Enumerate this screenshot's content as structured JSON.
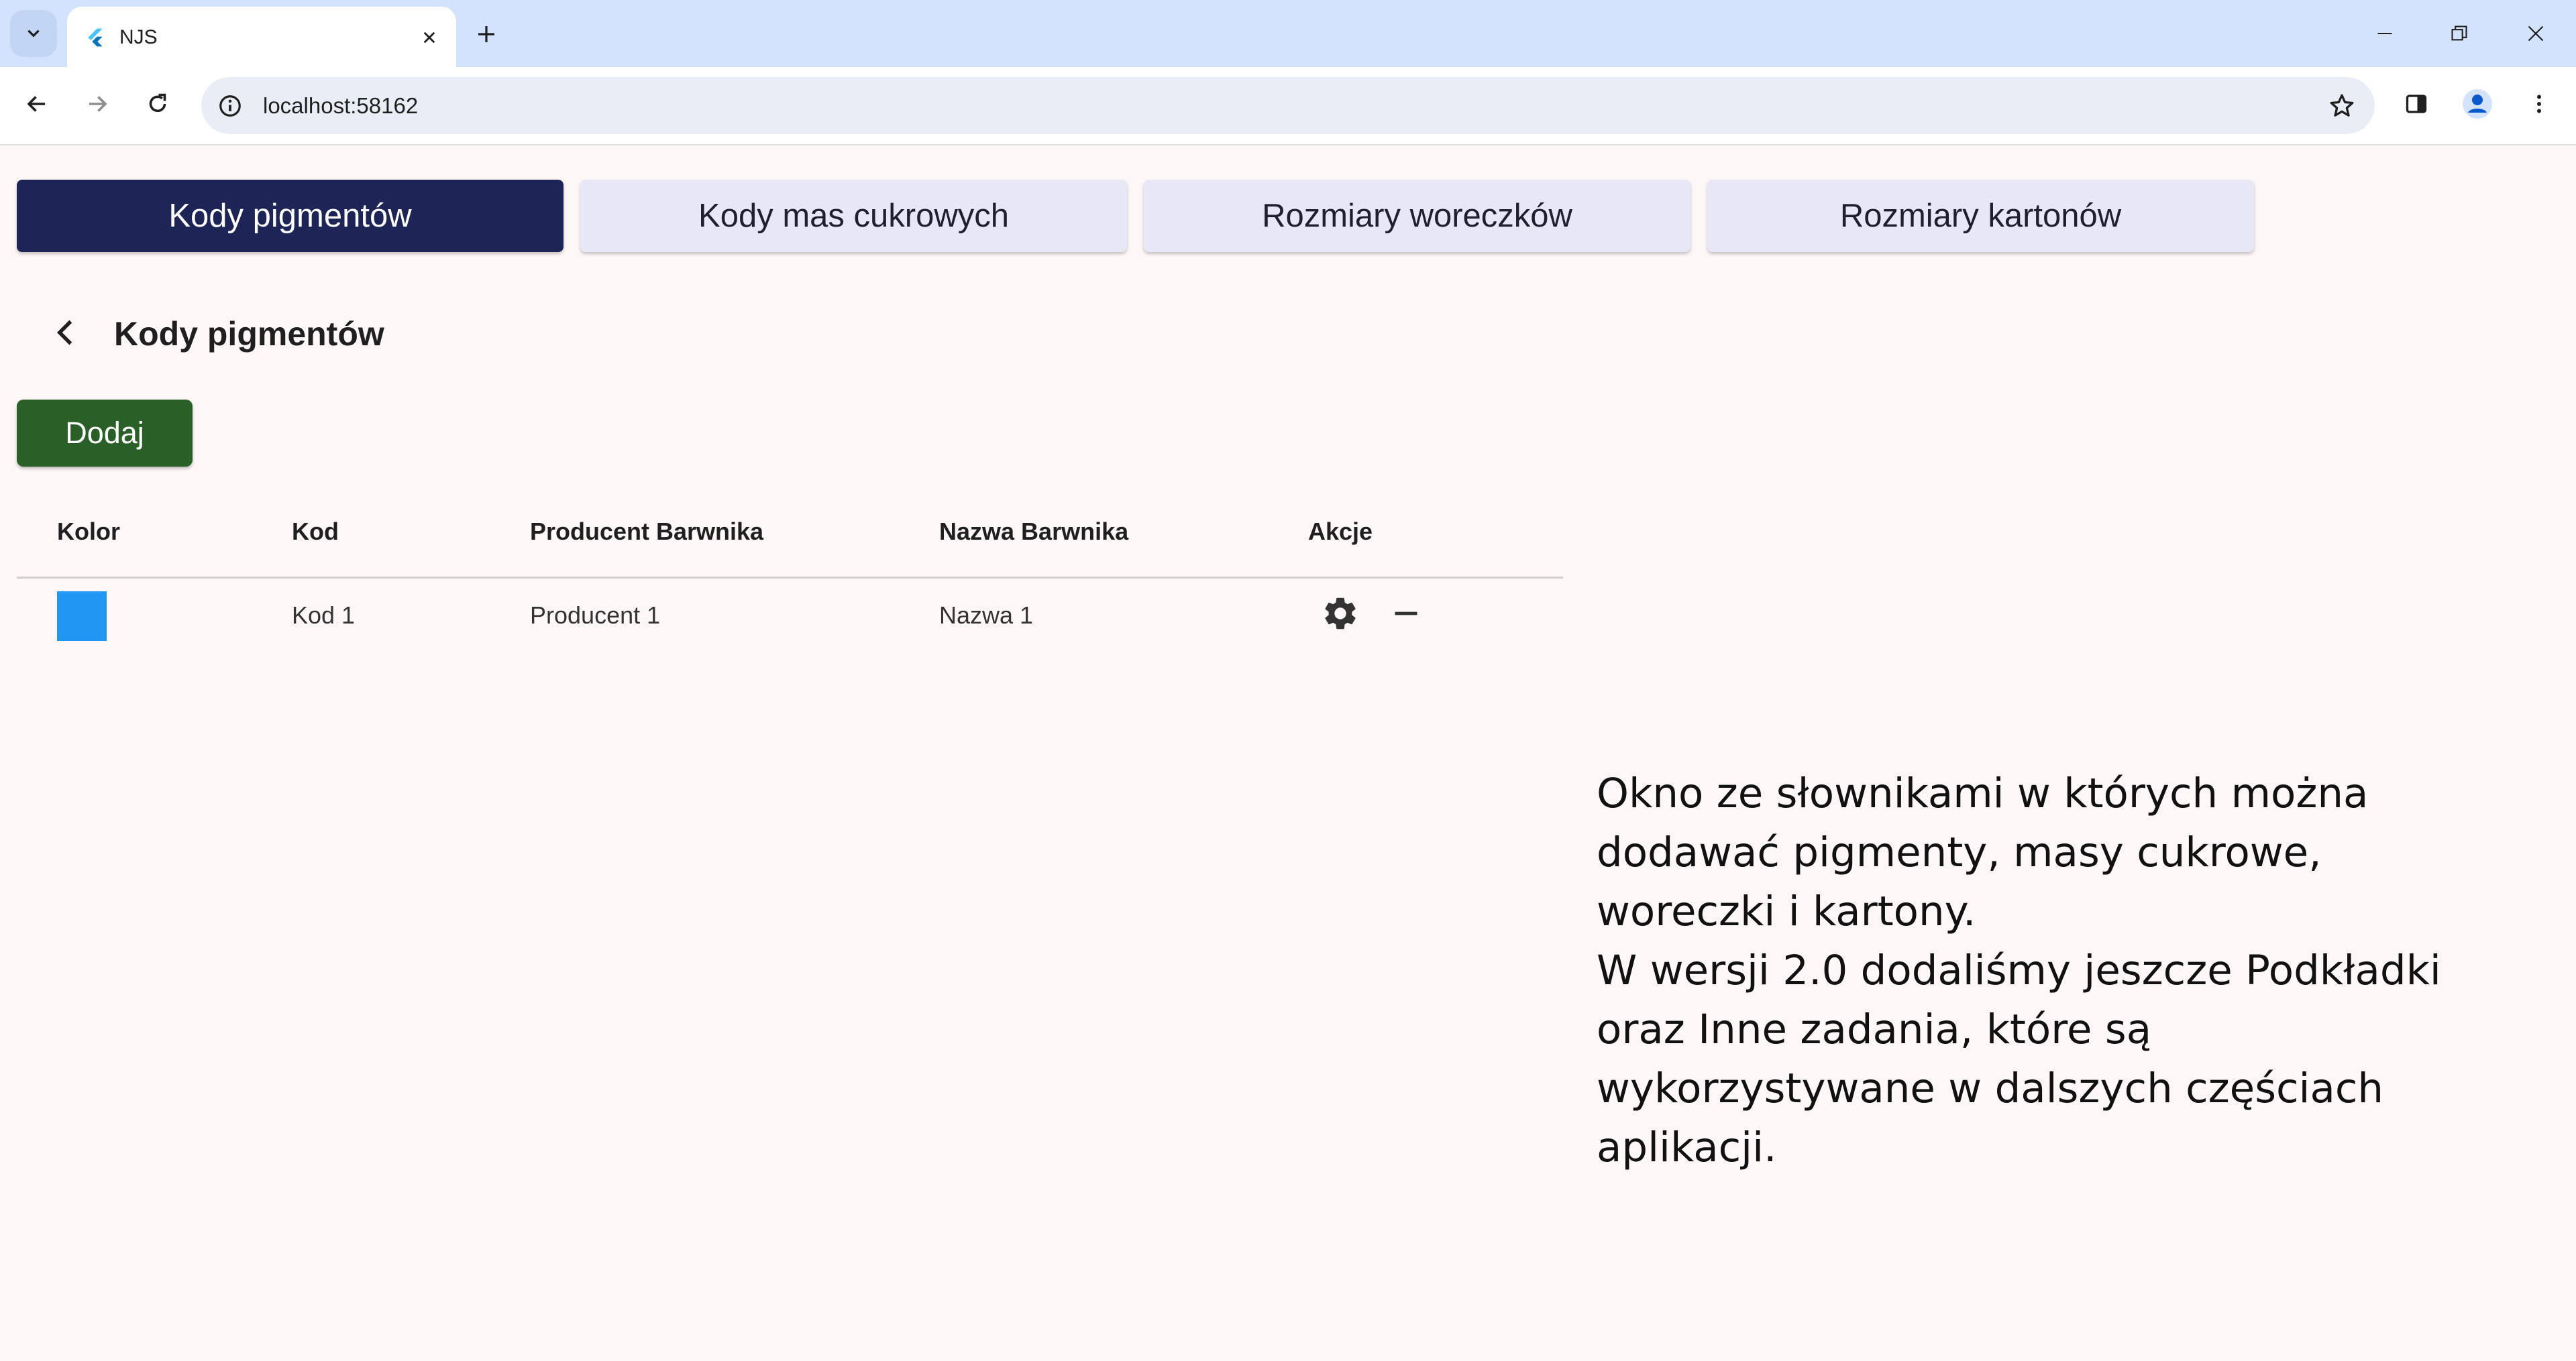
{
  "browser": {
    "tab_title": "NJS",
    "url": "localhost:58162"
  },
  "app": {
    "tabs": [
      {
        "label": "Kody pigmentów",
        "active": true
      },
      {
        "label": "Kody mas cukrowych",
        "active": false
      },
      {
        "label": "Rozmiary woreczków",
        "active": false
      },
      {
        "label": "Rozmiary kartonów",
        "active": false
      }
    ],
    "page_title": "Kody pigmentów",
    "add_button_label": "Dodaj",
    "table": {
      "headers": [
        "Kolor",
        "Kod",
        "Producent Barwnika",
        "Nazwa Barwnika",
        "Akcje"
      ],
      "rows": [
        {
          "color": "#2196f3",
          "code": "Kod 1",
          "producer": "Producent 1",
          "name": "Nazwa 1"
        }
      ]
    }
  },
  "description": {
    "lines": [
      "Okno ze słownikami w których można",
      "dodawać pigmenty, masy cukrowe,",
      "woreczki i kartony.",
      "W wersji 2.0 dodaliśmy jeszcze Podkładki",
      "oraz Inne zadania, które są",
      "wykorzystywane w dalszych częściach",
      "aplikacji."
    ]
  },
  "colors": {
    "active_tab": "#1d2456",
    "inactive_tab": "#e8e7f5",
    "add_button": "#2a6028",
    "page_background": "#fdf8f7",
    "tabstrip": "#d3e3fd"
  },
  "icons": {
    "tab_favicon": "flutter-icon",
    "row_edit": "gear-icon",
    "row_delete": "minus-icon"
  }
}
